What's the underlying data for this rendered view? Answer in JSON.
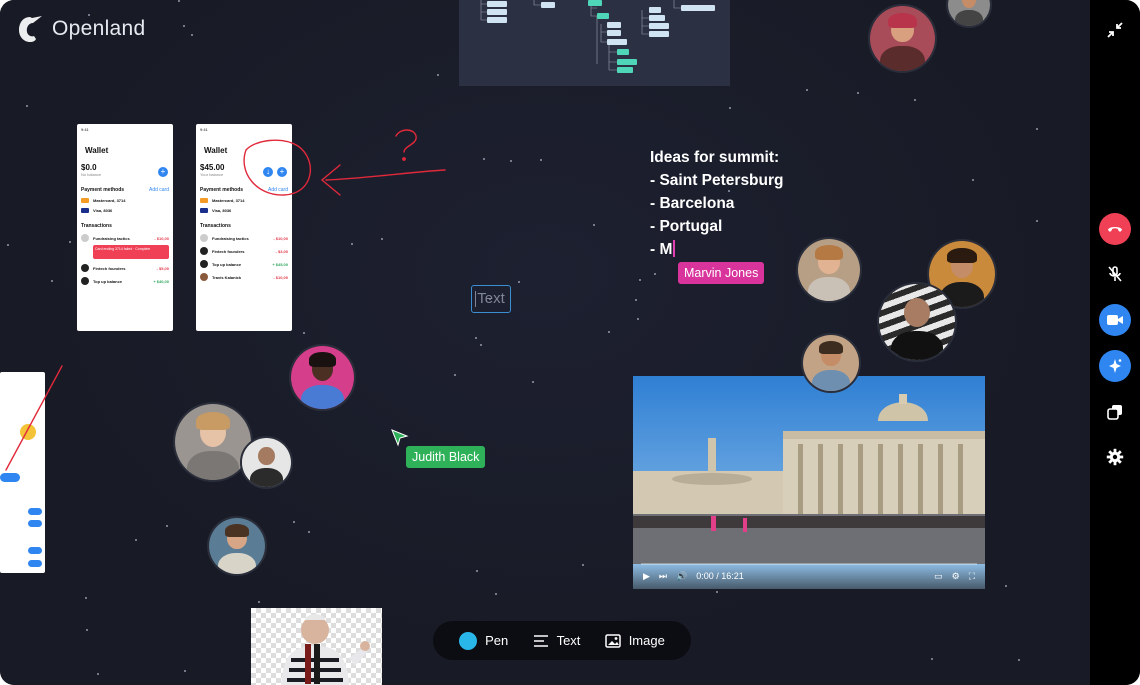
{
  "app": {
    "brand": "Openland"
  },
  "wallet_left": {
    "time": "9:41",
    "title": "Wallet",
    "balance": "$0.0",
    "balance_label": "No balance",
    "payment_methods_label": "Payment methods",
    "add_card": "Add card",
    "cards": [
      {
        "name": "Mastercard, 3714",
        "sub": "Valid 12/24"
      },
      {
        "name": "Visa, 8036",
        "sub": "Valid 10/23"
      }
    ],
    "transactions_label": "Transactions",
    "transactions": [
      {
        "name": "Fundraising tactics",
        "value": "- $10,00",
        "color": "#e23a4a"
      },
      {
        "name": "Fintech founders",
        "value": "- $5,00",
        "color": "#e23a4a"
      },
      {
        "name": "Top up balance",
        "value": "+ $40,00",
        "color": "#2fa65a"
      }
    ],
    "alert": "Card ending 3714 failed · Complete"
  },
  "wallet_right": {
    "time": "9:41",
    "title": "Wallet",
    "balance": "$45.00",
    "balance_label": "Your balance",
    "payment_methods_label": "Payment methods",
    "add_card": "Add card",
    "cards": [
      {
        "name": "Mastercard, 3714",
        "sub": "Valid 12/24"
      },
      {
        "name": "Visa, 8036",
        "sub": "Valid 10/23"
      }
    ],
    "transactions_label": "Transactions",
    "transactions": [
      {
        "name": "Fundraising tactics",
        "value": "- $10,00",
        "color": "#e23a4a"
      },
      {
        "name": "Fintech founders",
        "value": "- $3,00",
        "color": "#e23a4a"
      },
      {
        "name": "Top up balance",
        "value": "+ $45,00",
        "color": "#2fa65a"
      },
      {
        "name": "Travis Kalanick",
        "value": "- $10,00",
        "color": "#e23a4a"
      }
    ]
  },
  "ideas": {
    "lines": [
      "Ideas for summit:",
      "- Saint Petersburg",
      "- Barcelona",
      "- Portugal",
      "- M"
    ]
  },
  "cursors": {
    "marvin": "Marvin Jones",
    "judith": "Judith Black"
  },
  "text_placeholder": "Text",
  "video": {
    "time": "0:00 / 16:21",
    "progress": 0.0
  },
  "toolbar": {
    "pen": "Pen",
    "text": "Text",
    "image": "Image"
  },
  "colors": {
    "canvas": "#191b26",
    "pen_accent": "#29b6e8",
    "end_call": "#ef4056",
    "primary_blue": "#2f86f0",
    "marvin": "#d8349c",
    "judith": "#2fb15a"
  },
  "sidebar": [
    "minimize-icon",
    "end-call-icon",
    "mic-off-icon",
    "video-camera-icon",
    "effects-icon",
    "screen-share-icon",
    "settings-icon"
  ]
}
